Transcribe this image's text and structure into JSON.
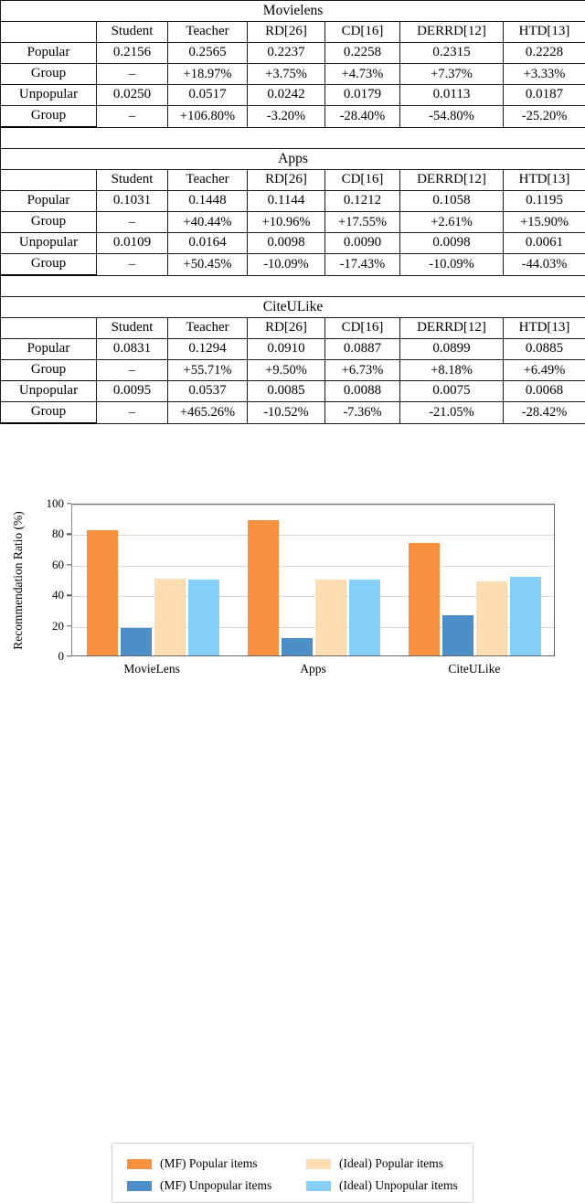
{
  "table": {
    "column_headers": [
      "",
      "Student",
      "Teacher",
      "RD[26]",
      "CD[16]",
      "DERRD[12]",
      "HTD[13]"
    ],
    "row_labels": {
      "popular_line1": "Popular",
      "popular_line2": "Group",
      "unpopular_line1": "Unpopular",
      "unpopular_line2": "Group"
    },
    "sections": [
      {
        "title": "Movielens",
        "popular_values": [
          "0.2156",
          "0.2565",
          "0.2237",
          "0.2258",
          "0.2315",
          "0.2228"
        ],
        "popular_deltas": [
          "–",
          "+18.97%",
          "+3.75%",
          "+4.73%",
          "+7.37%",
          "+3.33%"
        ],
        "unpopular_values": [
          "0.0250",
          "0.0517",
          "0.0242",
          "0.0179",
          "0.0113",
          "0.0187"
        ],
        "unpopular_deltas": [
          "–",
          "+106.80%",
          "-3.20%",
          "-28.40%",
          "-54.80%",
          "-25.20%"
        ]
      },
      {
        "title": "Apps",
        "popular_values": [
          "0.1031",
          "0.1448",
          "0.1144",
          "0.1212",
          "0.1058",
          "0.1195"
        ],
        "popular_deltas": [
          "–",
          "+40.44%",
          "+10.96%",
          "+17.55%",
          "+2.61%",
          "+15.90%"
        ],
        "unpopular_values": [
          "0.0109",
          "0.0164",
          "0.0098",
          "0.0090",
          "0.0098",
          "0.0061"
        ],
        "unpopular_deltas": [
          "–",
          "+50.45%",
          "-10.09%",
          "-17.43%",
          "-10.09%",
          "-44.03%"
        ]
      },
      {
        "title": "CiteULike",
        "popular_values": [
          "0.0831",
          "0.1294",
          "0.0910",
          "0.0887",
          "0.0899",
          "0.0885"
        ],
        "popular_deltas": [
          "–",
          "+55.71%",
          "+9.50%",
          "+6.73%",
          "+8.18%",
          "+6.49%"
        ],
        "unpopular_values": [
          "0.0095",
          "0.0537",
          "0.0085",
          "0.0088",
          "0.0075",
          "0.0068"
        ],
        "unpopular_deltas": [
          "–",
          "+465.26%",
          "-10.52%",
          "-7.36%",
          "-21.05%",
          "-28.42%"
        ]
      }
    ]
  },
  "chart_data": {
    "type": "bar",
    "title": "",
    "xlabel": "",
    "ylabel": "Recommendation Ratio (%)",
    "ylim": [
      0,
      100
    ],
    "yticks": [
      0,
      20,
      40,
      60,
      80,
      100
    ],
    "ytick_labels": [
      "0",
      "20",
      "40",
      "60",
      "80",
      "100"
    ],
    "grid": true,
    "legend_position": "below",
    "categories": [
      "MovieLens",
      "Apps",
      "CiteULike"
    ],
    "series": [
      {
        "name": "(MF) Popular items",
        "color": "#F8913F",
        "values": [
          81.8,
          88.6,
          73.8
        ]
      },
      {
        "name": "(MF) Unpopular items",
        "color": "#4B8FC6",
        "values": [
          18.2,
          11.4,
          26.2
        ]
      },
      {
        "name": "(Ideal) Popular items",
        "color": "#FDDDB1",
        "values": [
          50.4,
          50.0,
          48.7
        ]
      },
      {
        "name": "(Ideal) Unpopular items",
        "color": "#85CFF8",
        "values": [
          49.5,
          50.0,
          51.3
        ]
      }
    ]
  }
}
